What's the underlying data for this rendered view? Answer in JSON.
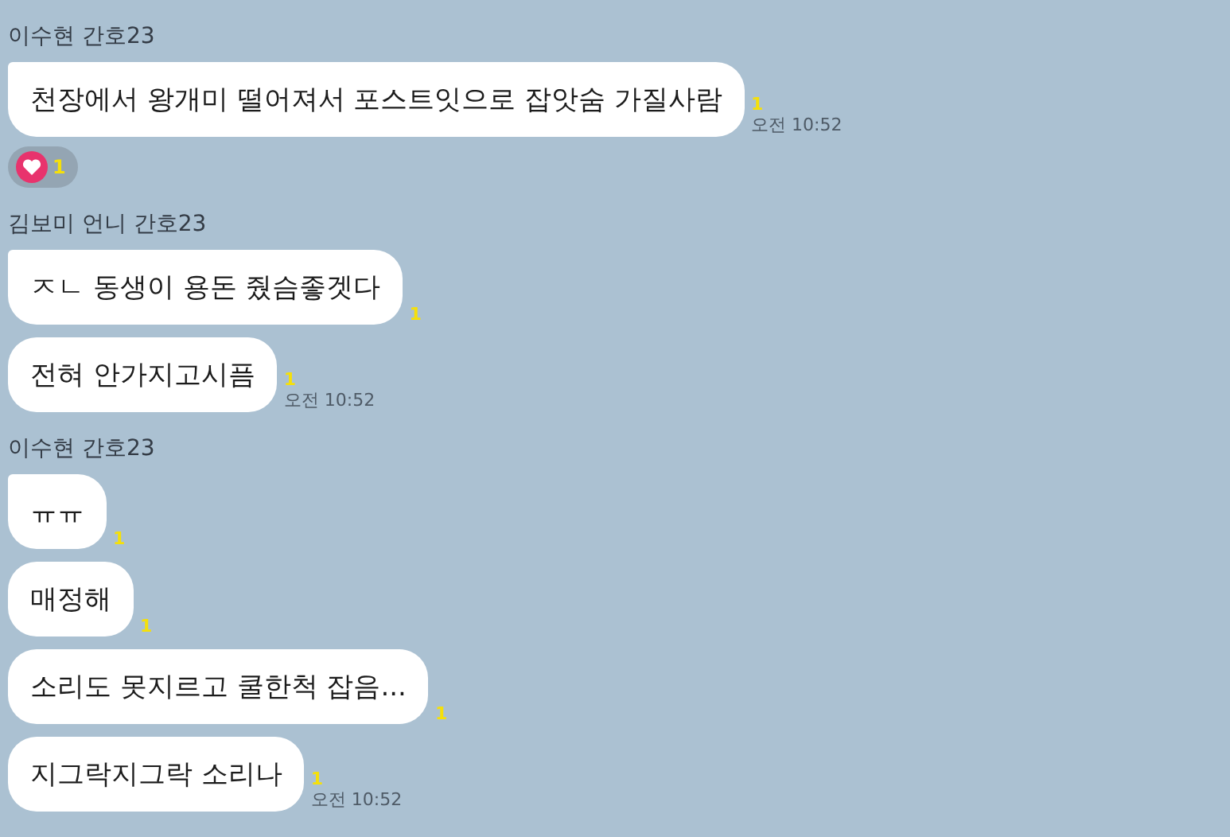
{
  "groups": [
    {
      "sender": "이수현 간호23",
      "messages": [
        {
          "text": "천장에서 왕개미 떨어져서 포스트잇으로 잡앗숨 가질사람",
          "unread": "1",
          "time": "오전 10:52",
          "reaction": {
            "count": "1"
          }
        }
      ]
    },
    {
      "sender": "김보미 언니 간호23",
      "messages": [
        {
          "text": "ㅈㄴ 동생이 용돈 줬슴좋겟다",
          "unread": "1"
        },
        {
          "text": "전혀 안가지고시픔",
          "unread": "1",
          "time": "오전 10:52"
        }
      ]
    },
    {
      "sender": "이수현 간호23",
      "messages": [
        {
          "text": "ㅠㅠ",
          "unread": "1"
        },
        {
          "text": "매정해",
          "unread": "1"
        },
        {
          "text": "소리도 못지르고 쿨한척 잡음...",
          "unread": "1"
        },
        {
          "text": "지그락지그락 소리나",
          "unread": "1",
          "time": "오전 10:52"
        }
      ]
    }
  ]
}
